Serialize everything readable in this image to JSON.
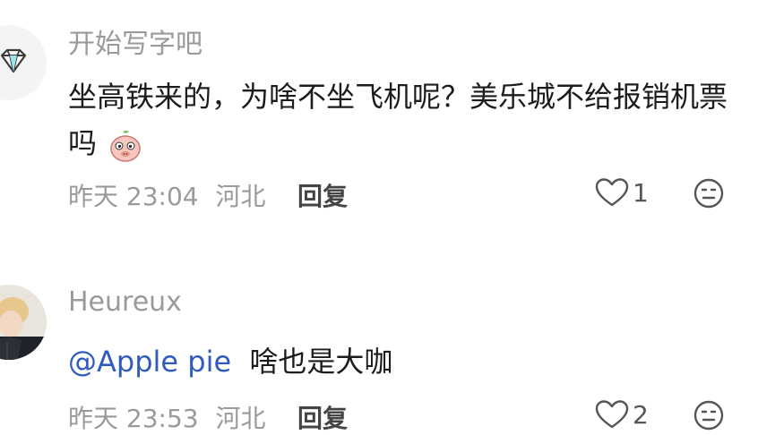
{
  "comments": [
    {
      "username": "开始写字吧",
      "text_main": "坐高铁来的，为啥不坐飞机呢？美乐城不给报销机票吗",
      "time": "昨天 23:04",
      "location": "河北",
      "reply_label": "回复",
      "likes": "1",
      "avatar_icon": "diamond-icon",
      "sticker": "pig-sticker-icon"
    },
    {
      "username": "Heureux",
      "mention": "@Apple pie",
      "text_main": "啥也是大咖",
      "time": "昨天 23:53",
      "location": "河北",
      "reply_label": "回复",
      "likes": "2",
      "avatar_icon": "user-photo"
    }
  ],
  "icons": {
    "like": "heart-icon",
    "reaction": "emoji-face-icon"
  },
  "colors": {
    "text": "#1c1c1c",
    "meta": "#9a9a9a",
    "mention": "#2f5bbf"
  }
}
